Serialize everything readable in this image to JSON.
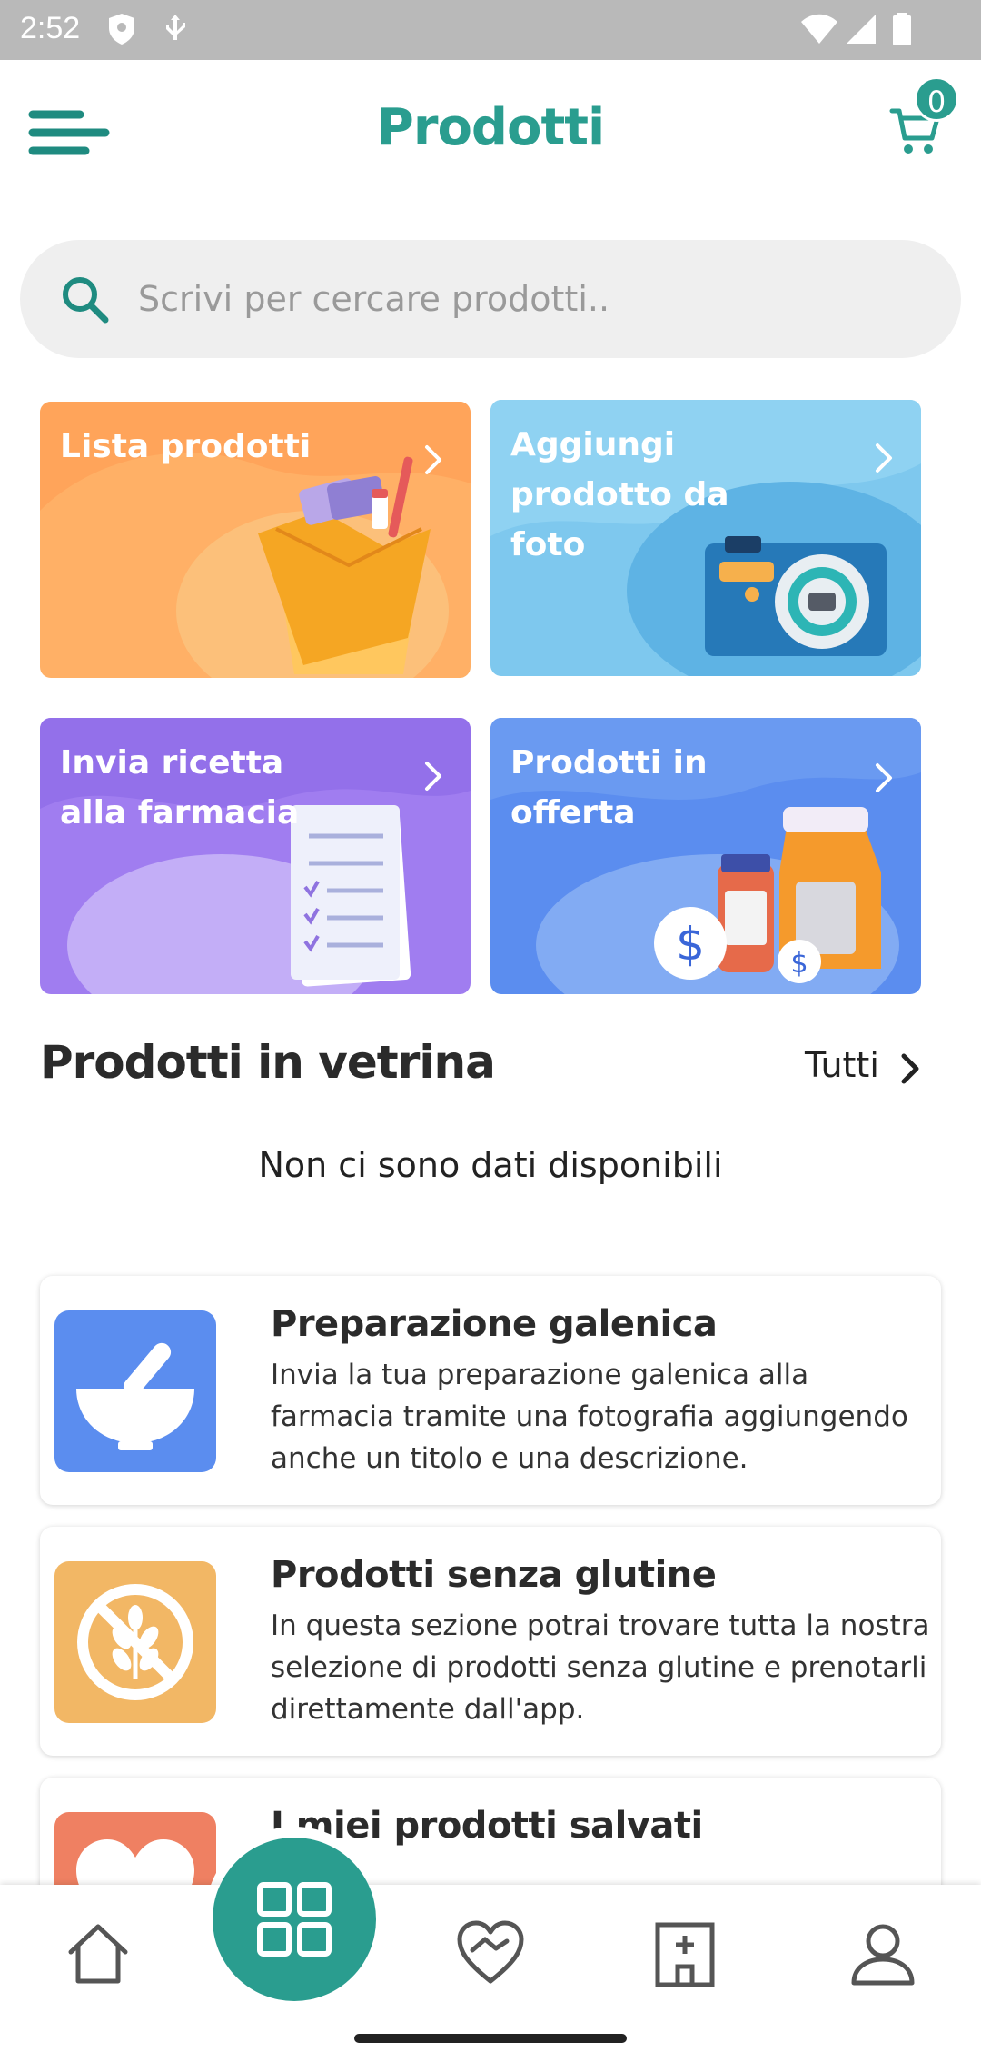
{
  "status_bar": {
    "time": "2:52"
  },
  "header": {
    "title": "Prodotti",
    "cart_count": "0"
  },
  "search": {
    "placeholder": "Scrivi per cercare prodotti.."
  },
  "tiles": [
    {
      "label": "Lista prodotti",
      "color": "#ffb066"
    },
    {
      "label": "Aggiungi prodotto da foto",
      "color": "#7ec8ee"
    },
    {
      "label": "Invia ricetta alla farmacia",
      "color": "#a07df0"
    },
    {
      "label": "Prodotti in offerta",
      "color": "#5b8def"
    }
  ],
  "featured": {
    "title": "Prodotti in vetrina",
    "link": "Tutti",
    "empty_text": "Non ci sono dati disponibili"
  },
  "cards": [
    {
      "title": "Preparazione galenica",
      "description": "Invia la tua preparazione galenica alla farmacia tramite una fotografia aggiungendo anche un titolo e una descrizione.",
      "icon": "mortar-pestle-icon",
      "color": "#5b8def"
    },
    {
      "title": "Prodotti senza glutine",
      "description": "In questa sezione potrai trovare tutta la nostra selezione di prodotti senza glutine e prenotarli direttamente dall'app.",
      "icon": "gluten-free-icon",
      "color": "#f2b765"
    },
    {
      "title": "I miei prodotti salvati",
      "description": "",
      "icon": "heart-icon",
      "color": "#ef8062"
    }
  ],
  "bottom_nav": [
    "home-icon",
    "products-grid-icon",
    "heart-handshake-icon",
    "pharmacy-icon",
    "profile-icon"
  ],
  "colors": {
    "accent": "#2a9d8f"
  }
}
